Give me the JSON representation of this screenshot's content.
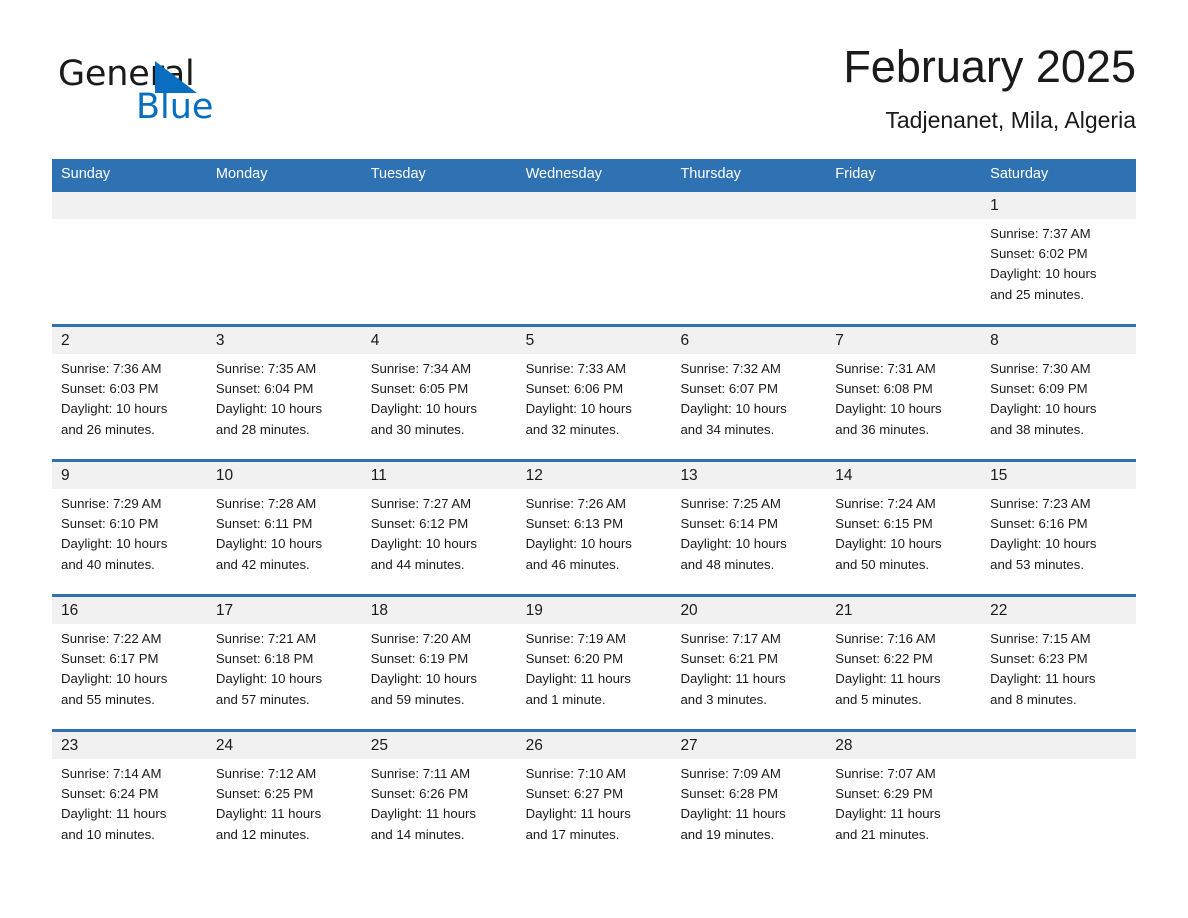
{
  "logo": {
    "word_1": "General",
    "word_2": "Blue",
    "triangle_icon": "triangle-icon",
    "blue_hex": "#0a6ec0"
  },
  "header": {
    "month_title": "February 2025",
    "location": "Tadjenanet, Mila, Algeria"
  },
  "theme": {
    "header_blue": "#2e72b3",
    "day_band_gray": "#f1f1f1",
    "text_dark": "#1a1a1a"
  },
  "calendar": {
    "weekdays": [
      "Sunday",
      "Monday",
      "Tuesday",
      "Wednesday",
      "Thursday",
      "Friday",
      "Saturday"
    ],
    "weeks": [
      [
        {
          "day": "",
          "sunrise": "",
          "sunset": "",
          "daylight_1": "",
          "daylight_2": ""
        },
        {
          "day": "",
          "sunrise": "",
          "sunset": "",
          "daylight_1": "",
          "daylight_2": ""
        },
        {
          "day": "",
          "sunrise": "",
          "sunset": "",
          "daylight_1": "",
          "daylight_2": ""
        },
        {
          "day": "",
          "sunrise": "",
          "sunset": "",
          "daylight_1": "",
          "daylight_2": ""
        },
        {
          "day": "",
          "sunrise": "",
          "sunset": "",
          "daylight_1": "",
          "daylight_2": ""
        },
        {
          "day": "",
          "sunrise": "",
          "sunset": "",
          "daylight_1": "",
          "daylight_2": ""
        },
        {
          "day": "1",
          "sunrise": "Sunrise: 7:37 AM",
          "sunset": "Sunset: 6:02 PM",
          "daylight_1": "Daylight: 10 hours",
          "daylight_2": "and 25 minutes."
        }
      ],
      [
        {
          "day": "2",
          "sunrise": "Sunrise: 7:36 AM",
          "sunset": "Sunset: 6:03 PM",
          "daylight_1": "Daylight: 10 hours",
          "daylight_2": "and 26 minutes."
        },
        {
          "day": "3",
          "sunrise": "Sunrise: 7:35 AM",
          "sunset": "Sunset: 6:04 PM",
          "daylight_1": "Daylight: 10 hours",
          "daylight_2": "and 28 minutes."
        },
        {
          "day": "4",
          "sunrise": "Sunrise: 7:34 AM",
          "sunset": "Sunset: 6:05 PM",
          "daylight_1": "Daylight: 10 hours",
          "daylight_2": "and 30 minutes."
        },
        {
          "day": "5",
          "sunrise": "Sunrise: 7:33 AM",
          "sunset": "Sunset: 6:06 PM",
          "daylight_1": "Daylight: 10 hours",
          "daylight_2": "and 32 minutes."
        },
        {
          "day": "6",
          "sunrise": "Sunrise: 7:32 AM",
          "sunset": "Sunset: 6:07 PM",
          "daylight_1": "Daylight: 10 hours",
          "daylight_2": "and 34 minutes."
        },
        {
          "day": "7",
          "sunrise": "Sunrise: 7:31 AM",
          "sunset": "Sunset: 6:08 PM",
          "daylight_1": "Daylight: 10 hours",
          "daylight_2": "and 36 minutes."
        },
        {
          "day": "8",
          "sunrise": "Sunrise: 7:30 AM",
          "sunset": "Sunset: 6:09 PM",
          "daylight_1": "Daylight: 10 hours",
          "daylight_2": "and 38 minutes."
        }
      ],
      [
        {
          "day": "9",
          "sunrise": "Sunrise: 7:29 AM",
          "sunset": "Sunset: 6:10 PM",
          "daylight_1": "Daylight: 10 hours",
          "daylight_2": "and 40 minutes."
        },
        {
          "day": "10",
          "sunrise": "Sunrise: 7:28 AM",
          "sunset": "Sunset: 6:11 PM",
          "daylight_1": "Daylight: 10 hours",
          "daylight_2": "and 42 minutes."
        },
        {
          "day": "11",
          "sunrise": "Sunrise: 7:27 AM",
          "sunset": "Sunset: 6:12 PM",
          "daylight_1": "Daylight: 10 hours",
          "daylight_2": "and 44 minutes."
        },
        {
          "day": "12",
          "sunrise": "Sunrise: 7:26 AM",
          "sunset": "Sunset: 6:13 PM",
          "daylight_1": "Daylight: 10 hours",
          "daylight_2": "and 46 minutes."
        },
        {
          "day": "13",
          "sunrise": "Sunrise: 7:25 AM",
          "sunset": "Sunset: 6:14 PM",
          "daylight_1": "Daylight: 10 hours",
          "daylight_2": "and 48 minutes."
        },
        {
          "day": "14",
          "sunrise": "Sunrise: 7:24 AM",
          "sunset": "Sunset: 6:15 PM",
          "daylight_1": "Daylight: 10 hours",
          "daylight_2": "and 50 minutes."
        },
        {
          "day": "15",
          "sunrise": "Sunrise: 7:23 AM",
          "sunset": "Sunset: 6:16 PM",
          "daylight_1": "Daylight: 10 hours",
          "daylight_2": "and 53 minutes."
        }
      ],
      [
        {
          "day": "16",
          "sunrise": "Sunrise: 7:22 AM",
          "sunset": "Sunset: 6:17 PM",
          "daylight_1": "Daylight: 10 hours",
          "daylight_2": "and 55 minutes."
        },
        {
          "day": "17",
          "sunrise": "Sunrise: 7:21 AM",
          "sunset": "Sunset: 6:18 PM",
          "daylight_1": "Daylight: 10 hours",
          "daylight_2": "and 57 minutes."
        },
        {
          "day": "18",
          "sunrise": "Sunrise: 7:20 AM",
          "sunset": "Sunset: 6:19 PM",
          "daylight_1": "Daylight: 10 hours",
          "daylight_2": "and 59 minutes."
        },
        {
          "day": "19",
          "sunrise": "Sunrise: 7:19 AM",
          "sunset": "Sunset: 6:20 PM",
          "daylight_1": "Daylight: 11 hours",
          "daylight_2": "and 1 minute."
        },
        {
          "day": "20",
          "sunrise": "Sunrise: 7:17 AM",
          "sunset": "Sunset: 6:21 PM",
          "daylight_1": "Daylight: 11 hours",
          "daylight_2": "and 3 minutes."
        },
        {
          "day": "21",
          "sunrise": "Sunrise: 7:16 AM",
          "sunset": "Sunset: 6:22 PM",
          "daylight_1": "Daylight: 11 hours",
          "daylight_2": "and 5 minutes."
        },
        {
          "day": "22",
          "sunrise": "Sunrise: 7:15 AM",
          "sunset": "Sunset: 6:23 PM",
          "daylight_1": "Daylight: 11 hours",
          "daylight_2": "and 8 minutes."
        }
      ],
      [
        {
          "day": "23",
          "sunrise": "Sunrise: 7:14 AM",
          "sunset": "Sunset: 6:24 PM",
          "daylight_1": "Daylight: 11 hours",
          "daylight_2": "and 10 minutes."
        },
        {
          "day": "24",
          "sunrise": "Sunrise: 7:12 AM",
          "sunset": "Sunset: 6:25 PM",
          "daylight_1": "Daylight: 11 hours",
          "daylight_2": "and 12 minutes."
        },
        {
          "day": "25",
          "sunrise": "Sunrise: 7:11 AM",
          "sunset": "Sunset: 6:26 PM",
          "daylight_1": "Daylight: 11 hours",
          "daylight_2": "and 14 minutes."
        },
        {
          "day": "26",
          "sunrise": "Sunrise: 7:10 AM",
          "sunset": "Sunset: 6:27 PM",
          "daylight_1": "Daylight: 11 hours",
          "daylight_2": "and 17 minutes."
        },
        {
          "day": "27",
          "sunrise": "Sunrise: 7:09 AM",
          "sunset": "Sunset: 6:28 PM",
          "daylight_1": "Daylight: 11 hours",
          "daylight_2": "and 19 minutes."
        },
        {
          "day": "28",
          "sunrise": "Sunrise: 7:07 AM",
          "sunset": "Sunset: 6:29 PM",
          "daylight_1": "Daylight: 11 hours",
          "daylight_2": "and 21 minutes."
        },
        {
          "day": "",
          "sunrise": "",
          "sunset": "",
          "daylight_1": "",
          "daylight_2": ""
        }
      ]
    ]
  }
}
